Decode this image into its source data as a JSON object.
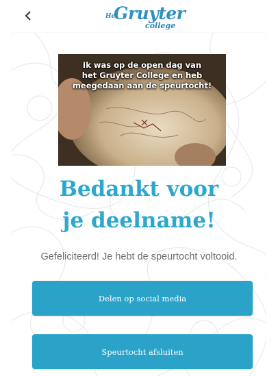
{
  "header": {
    "back_icon": "chevron-left-icon",
    "logo": {
      "het": "Het",
      "name": "Gruyter",
      "sub": "college"
    }
  },
  "photo": {
    "caption_lines": [
      "Ik was op de open dag van",
      "het Gruyter College en heb",
      "meegedaan aan de speurtocht!"
    ]
  },
  "title_lines": [
    "Bedankt voor",
    "je deelname!"
  ],
  "subtitle": "Gefeliciteerd! Je hebt de speurtocht voltooid.",
  "buttons": {
    "share": "Delen op social media",
    "close": "Speurtocht afsluiten"
  },
  "colors": {
    "accent": "#2ba3c9",
    "title": "#2ba8cc",
    "logo": "#2f8fc4"
  }
}
